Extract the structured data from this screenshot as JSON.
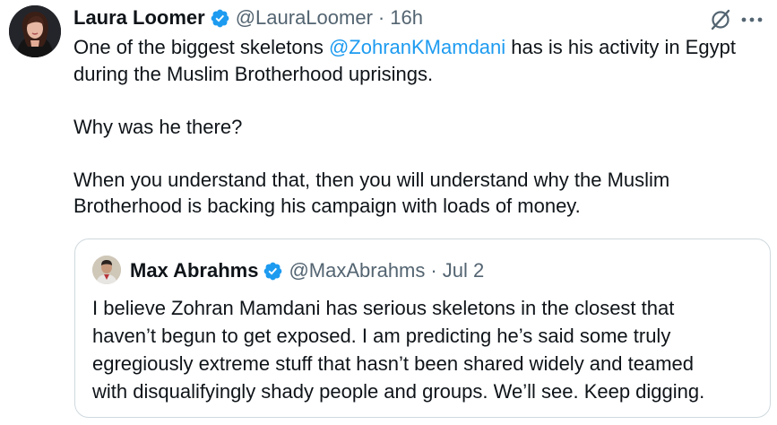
{
  "tweet": {
    "author_name": "Laura Loomer",
    "author_handle": "@LauraLoomer",
    "separator": "·",
    "time": "16h",
    "text_line1_before": "One of the biggest skeletons ",
    "mention": "@ZohranKMamdani",
    "text_line1_after": " has is his activity in Egypt",
    "text_line2": "during the Muslim Brotherhood uprisings.",
    "text_line3": "Why was he there?",
    "text_line4": "When you understand that, then you will understand why the Muslim",
    "text_line5": "Brotherhood is backing his campaign with loads of money."
  },
  "quote": {
    "author_name": "Max Abrahms",
    "author_handle": "@MaxAbrahms",
    "separator": "·",
    "time": "Jul 2",
    "lines": [
      "I believe Zohran Mamdani has serious skeletons in the closest that",
      "haven’t begun to get exposed. I am predicting he’s said some truly",
      "egregiously extreme stuff that hasn’t been shared widely and teamed",
      "with disqualifyingly shady people and groups. We’ll see. Keep digging."
    ]
  },
  "icons": {
    "verified": "verified-badge-icon",
    "grok": "grok-icon",
    "more": "more-options-icon"
  },
  "colors": {
    "text": "#0f1419",
    "secondary": "#536471",
    "link": "#1d9bf0",
    "verified": "#1d9bf0",
    "border": "#cfd9de"
  }
}
